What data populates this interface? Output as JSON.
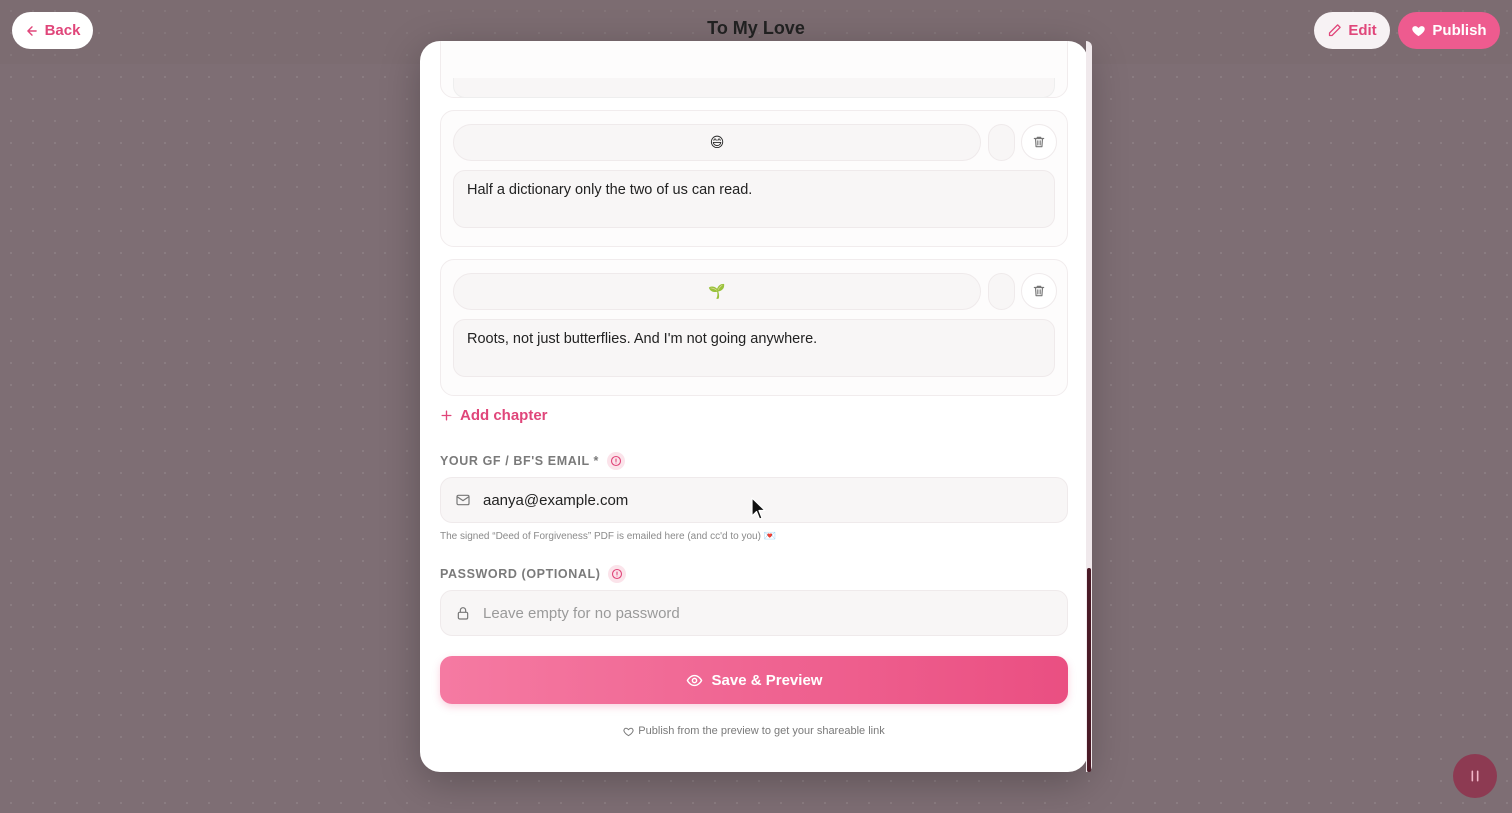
{
  "header": {
    "title": "To My Love",
    "back_label": "Back",
    "edit_label": "Edit",
    "publish_label": "Publish"
  },
  "chapters": [
    {
      "emoji": "😄",
      "text": "Half a dictionary only the two of us can read."
    },
    {
      "emoji": "🌱",
      "text": "Roots, not just butterflies. And I'm not going anywhere."
    }
  ],
  "add_chapter_label": "Add chapter",
  "email": {
    "label": "YOUR GF / BF'S EMAIL *",
    "value": "aanya@example.com",
    "helper": "The signed “Deed of Forgiveness” PDF is emailed here (and cc'd to you) 💌"
  },
  "password": {
    "label": "PASSWORD (OPTIONAL)",
    "placeholder": "Leave empty for no password"
  },
  "save_label": "Save & Preview",
  "footnote": "Publish from the preview to get your shareable link",
  "colors": {
    "accent": "#e0467a",
    "button_start": "#f57aa2",
    "button_end": "#ea4f82"
  }
}
